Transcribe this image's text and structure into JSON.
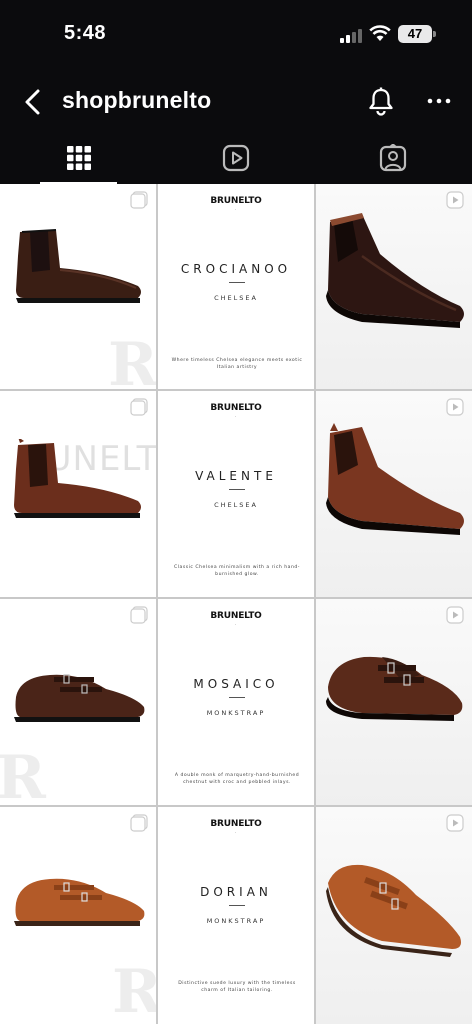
{
  "status_bar": {
    "time": "5:48",
    "battery": "47"
  },
  "header": {
    "username": "shopbrunelto"
  },
  "tabs": [
    {
      "name": "grid",
      "icon": "grid-icon"
    },
    {
      "name": "reels",
      "icon": "reels-icon"
    },
    {
      "name": "tagged",
      "icon": "tagged-person-icon"
    }
  ],
  "grid": {
    "cards": [
      {
        "brand": "BRUNELTO",
        "model": "CROCIANOO",
        "style": "CHELSEA",
        "tagline": "Where timeless Chelsea elegance meets exotic Italian artistry"
      },
      {
        "brand": "BRUNELTO",
        "model": "VALENTE",
        "style": "CHELSEA",
        "tagline": "Classic Chelsea minimalism with a rich hand-burnished glow."
      },
      {
        "brand": "BRUNELTO",
        "model": "MOSAICO",
        "style": "MONKSTRAP",
        "tagline": "A double monk of marquetry-hand-burnished chestnut with croc and pebbled inlays."
      },
      {
        "brand": "BRUNELTO",
        "model": "DORIAN",
        "style": "MONKSTRAP",
        "tagline": "Distinctive suede luxury with the timeless charm of Italian tailoring."
      }
    ],
    "photo_watermark_text": "RUNELTO",
    "colors": {
      "dark_brown": "#3a1e14",
      "chestnut": "#6b2e1c",
      "suede": "#b35a28"
    }
  }
}
